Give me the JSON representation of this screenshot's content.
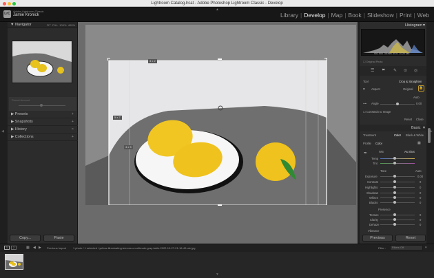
{
  "window": {
    "title": "Lightroom Catalog.lrcat - Adobe Photoshop Lightroom Classic - Develop"
  },
  "header": {
    "brand": "Adobe Lightroom Classic",
    "user": "Jamie Kronick",
    "logo_text": "LrC",
    "modules": [
      "Library",
      "Develop",
      "Map",
      "Book",
      "Slideshow",
      "Print",
      "Web"
    ],
    "active_module": "Develop"
  },
  "left_panel": {
    "navigator": {
      "title": "Navigator",
      "zoom_options": [
        "FIT",
        "FILL",
        "100%",
        "400%"
      ]
    },
    "preset_amount": {
      "label": "Preset Amount"
    },
    "sections": [
      {
        "label": "Presets"
      },
      {
        "label": "Snapshots"
      },
      {
        "label": "History"
      },
      {
        "label": "Collections"
      }
    ],
    "copy_button": "Copy...",
    "paste_button": "Paste"
  },
  "canvas": {
    "aspect_labels": [
      "3 x 2",
      "5 x 7",
      "4 x 5"
    ]
  },
  "right_panel": {
    "histogram": {
      "title": "Histogram",
      "readout": [
        "ISO 500",
        "35 mm",
        "f/5.6",
        "1/320 sec"
      ],
      "original_photo": "Original Photo"
    },
    "crop": {
      "tool": "Tool",
      "title": "Crop & Straighten",
      "aspect_label": "Aspect",
      "aspect_value": "Original",
      "auto": "Auto",
      "angle_label": "Angle",
      "angle_value": "0.00",
      "constrain": "Constrain to Image",
      "reset": "Reset",
      "close": "Close"
    },
    "basic": {
      "title": "Basic",
      "treatment": "Treatment",
      "color": "Color",
      "bw": "Black & White",
      "profile_label": "Profile",
      "profile_value": "Color",
      "wb_label": "WB",
      "wb_value": "As Shot",
      "temp": "Temp",
      "tint": "Tint",
      "tone": "Tone",
      "tone_auto": "Auto",
      "tone_sliders": [
        {
          "label": "Exposure",
          "value": "0.00"
        },
        {
          "label": "Contrast",
          "value": "0"
        },
        {
          "label": "Highlights",
          "value": "0"
        },
        {
          "label": "Shadows",
          "value": "0"
        },
        {
          "label": "Whites",
          "value": "0"
        },
        {
          "label": "Blacks",
          "value": "0"
        }
      ],
      "presence": "Presence",
      "presence_sliders": [
        {
          "label": "Texture",
          "value": "0"
        },
        {
          "label": "Clarity",
          "value": "0"
        },
        {
          "label": "Dehaze",
          "value": "0"
        }
      ],
      "vibrance": "Vibrance"
    },
    "previous_button": "Previous",
    "reset_button": "Reset"
  },
  "filmstrip": {
    "source": "Previous Import",
    "info": "1 photo / 1 selected / yellow-illuminating-lemons-on-ultimate-gray-table-2022-10-27-21-16-49-utc.jpg",
    "filter_label": "Filter :",
    "filter_value": "Filters Off",
    "page_numbers": [
      "1",
      "2"
    ]
  }
}
